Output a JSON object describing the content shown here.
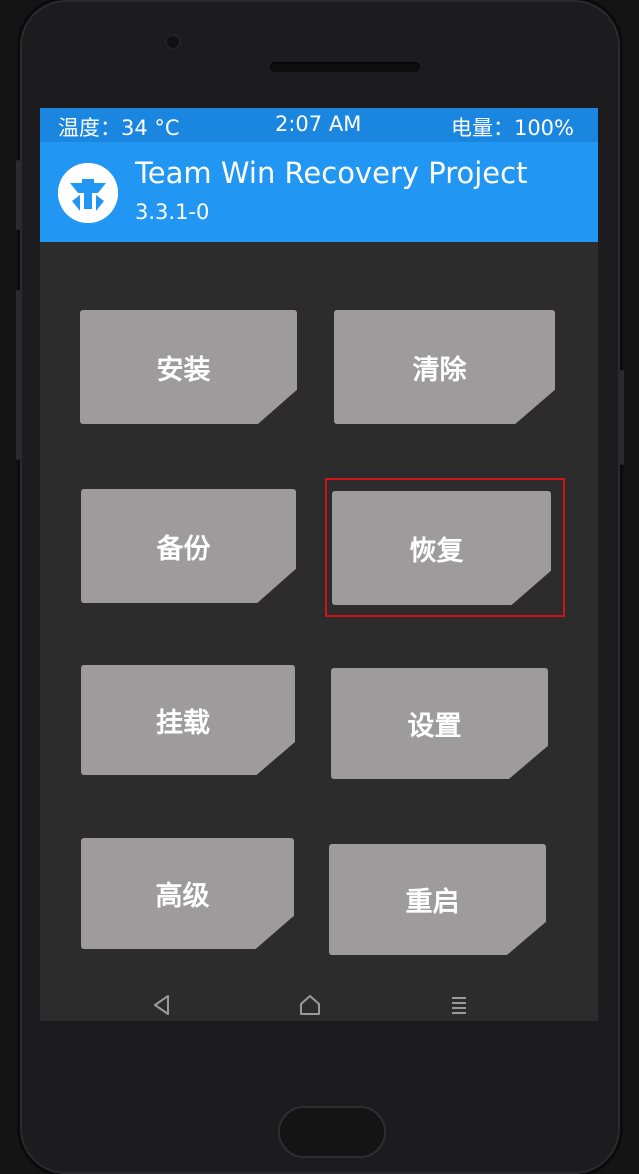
{
  "status": {
    "temperature": "温度：34 °C",
    "time": "2:07 AM",
    "battery": "电量：100%"
  },
  "header": {
    "title": "Team Win Recovery Project",
    "version": "3.3.1-0",
    "logo_icon": "twrp-logo-icon"
  },
  "menu": {
    "install": "安装",
    "wipe": "清除",
    "backup": "备份",
    "restore": "恢复",
    "mount": "挂载",
    "settings": "设置",
    "advanced": "高级",
    "reboot": "重启"
  },
  "highlighted_item": "restore",
  "nav": {
    "back_icon": "back-triangle-icon",
    "home_icon": "home-icon",
    "menu_icon": "menu-lines-icon"
  },
  "colors": {
    "statusbar": "#1a86e0",
    "header": "#2196f3",
    "tile": "#9e9b9c",
    "background": "#2c2c2d",
    "highlight": "#d0121b"
  }
}
